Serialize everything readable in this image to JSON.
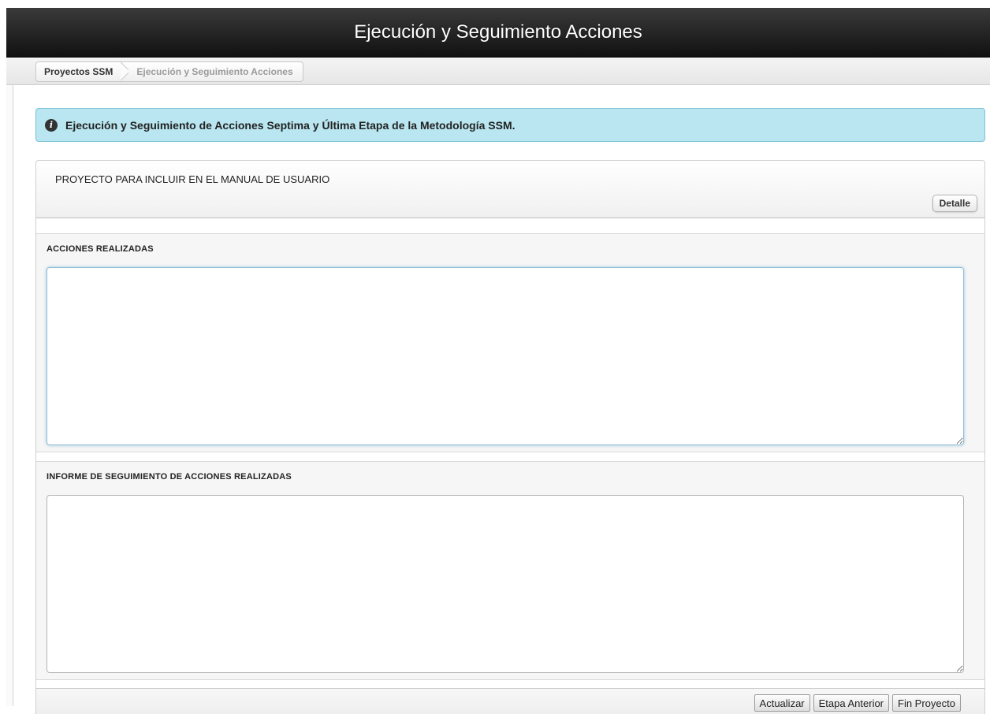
{
  "header": {
    "title": "Ejecución y Seguimiento Acciones"
  },
  "breadcrumb": {
    "home": "Proyectos SSM",
    "current": "Ejecución y Seguimiento Acciones"
  },
  "info": {
    "icon": "info-icon",
    "message": "Ejecución y Seguimiento de Acciones Septima y Última Etapa de la Metodología SSM."
  },
  "project": {
    "title": "PROYECTO PARA INCLUIR EN EL MANUAL DE USUARIO",
    "detail_label": "Detalle"
  },
  "sections": [
    {
      "label": "ACCIONES REALIZADAS",
      "value": ""
    },
    {
      "label": "INFORME DE SEGUIMIENTO DE ACCIONES REALIZADAS",
      "value": ""
    }
  ],
  "footer": {
    "update_label": "Actualizar",
    "previous_label": "Etapa Anterior",
    "finish_label": "Fin Proyecto"
  },
  "colors": {
    "header_bg": "#1a1a1a",
    "info_bg": "#b9e6f0",
    "info_border": "#7cc3d6"
  }
}
